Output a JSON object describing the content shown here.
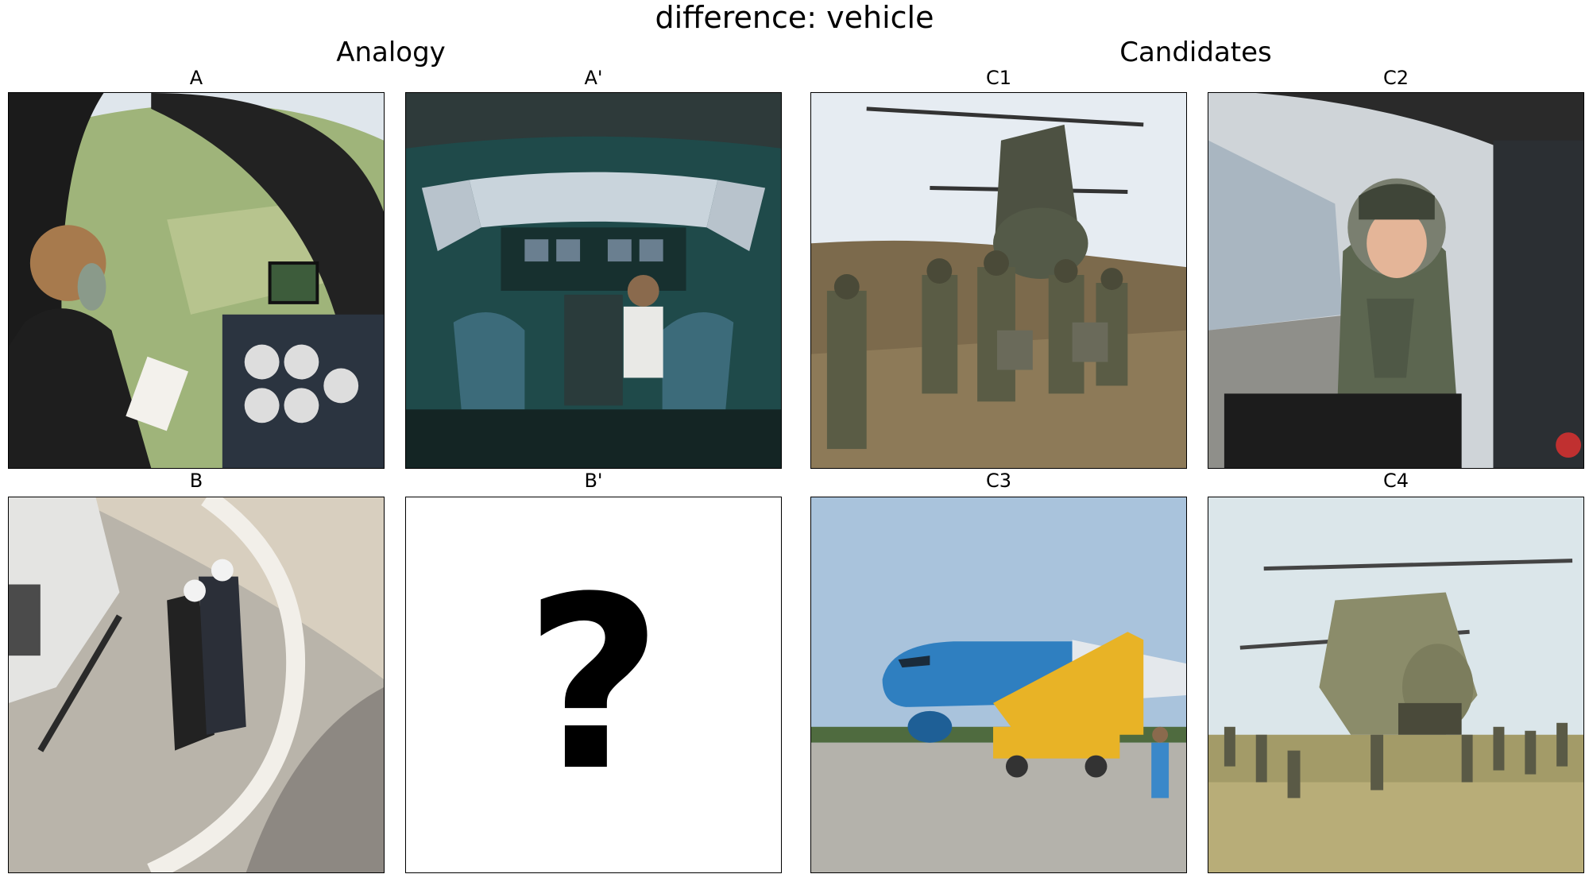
{
  "title": "difference: vehicle",
  "sections": {
    "analogy": "Analogy",
    "candidates": "Candidates"
  },
  "panels": {
    "A": {
      "label": "A"
    },
    "A_prime": {
      "label": "A'"
    },
    "B": {
      "label": "B"
    },
    "B_prime": {
      "label": "B'",
      "placeholder": "?"
    },
    "C1": {
      "label": "C1"
    },
    "C2": {
      "label": "C2"
    },
    "C3": {
      "label": "C3"
    },
    "C4": {
      "label": "C4"
    }
  },
  "colors": {
    "sky": "#cfe0ee",
    "grass": "#8fa86a",
    "olive": "#5f6650",
    "tarmac": "#b9b4aa",
    "jetblue": "#2f7fc0",
    "stairs": "#e8b326",
    "cockpit": "#1f4a4a"
  }
}
